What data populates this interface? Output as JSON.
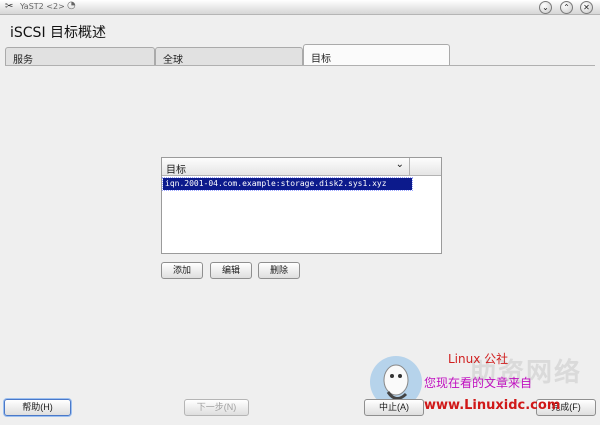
{
  "window": {
    "app_icon": "✂",
    "title": "YaST2 <2>",
    "controls": [
      "minimize-icon",
      "maximize-icon",
      "close-icon"
    ]
  },
  "page": {
    "title": "iSCSI 目标概述"
  },
  "tabs": [
    {
      "label": "服务",
      "active": false
    },
    {
      "label": "全球",
      "active": false
    },
    {
      "label": "目标",
      "active": true
    }
  ],
  "targets_table": {
    "column_header": "目标",
    "sort_icon": "chevron-down-icon",
    "rows": [
      {
        "target": "iqn.2001-04.com.example:storage.disk2.sys1.xyz",
        "selected": true
      }
    ]
  },
  "table_actions": {
    "add": "添加",
    "edit": "编辑",
    "delete": "删除"
  },
  "footer": {
    "help": "帮助(H)",
    "next": "下一步(N)",
    "abort": "中止(A)",
    "finish": "完成(F)"
  },
  "watermark": {
    "line1": "Linux 公社",
    "line2": "您现在看的文章来自",
    "line3": "www.Linuxidc.com",
    "faded": "助资网络"
  },
  "colors": {
    "selection": "#0c1a8c",
    "accent": "#4a78c8",
    "watermark_red": "#d01818",
    "watermark_magenta": "#c010c0"
  }
}
